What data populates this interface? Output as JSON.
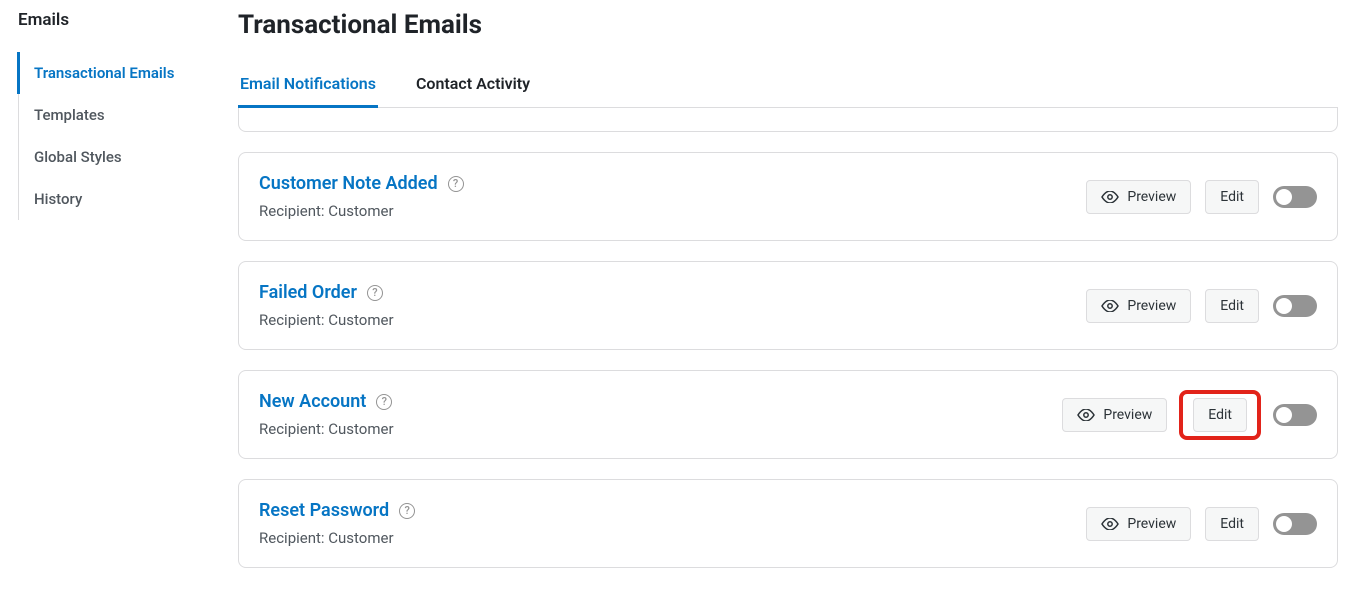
{
  "sidebar": {
    "title": "Emails",
    "items": [
      {
        "label": "Transactional Emails",
        "active": true
      },
      {
        "label": "Templates",
        "active": false
      },
      {
        "label": "Global Styles",
        "active": false
      },
      {
        "label": "History",
        "active": false
      }
    ]
  },
  "page": {
    "title": "Transactional Emails"
  },
  "tabs": [
    {
      "label": "Email Notifications",
      "active": true
    },
    {
      "label": "Contact Activity",
      "active": false
    }
  ],
  "buttons": {
    "preview": "Preview",
    "edit": "Edit"
  },
  "recipient_prefix": "Recipient: ",
  "cards": [
    {
      "title": "Customer Note Added",
      "recipient": "Customer",
      "highlighted": false
    },
    {
      "title": "Failed Order",
      "recipient": "Customer",
      "highlighted": false
    },
    {
      "title": "New Account",
      "recipient": "Customer",
      "highlighted": true
    },
    {
      "title": "Reset Password",
      "recipient": "Customer",
      "highlighted": false
    }
  ]
}
